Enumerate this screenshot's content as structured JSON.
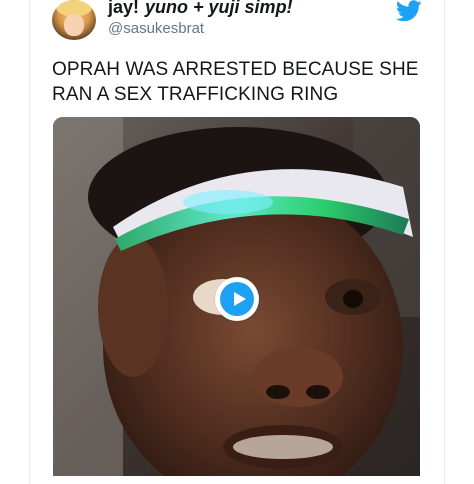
{
  "tweet": {
    "display_name_plain": "jay!",
    "display_name_fancy": "yuno + yuji simp!",
    "handle": "@sasukesbrat",
    "text_line1": "OPRAH WAS ARRESTED BECAUSE SHE",
    "text_line2": "RAN A SEX TRAFFICKING RING"
  },
  "icons": {
    "brand": "twitter-bird-icon",
    "media_control": "play-icon"
  },
  "colors": {
    "twitter_blue": "#1da1f2",
    "text_primary": "#14171a",
    "text_secondary": "#657786"
  }
}
